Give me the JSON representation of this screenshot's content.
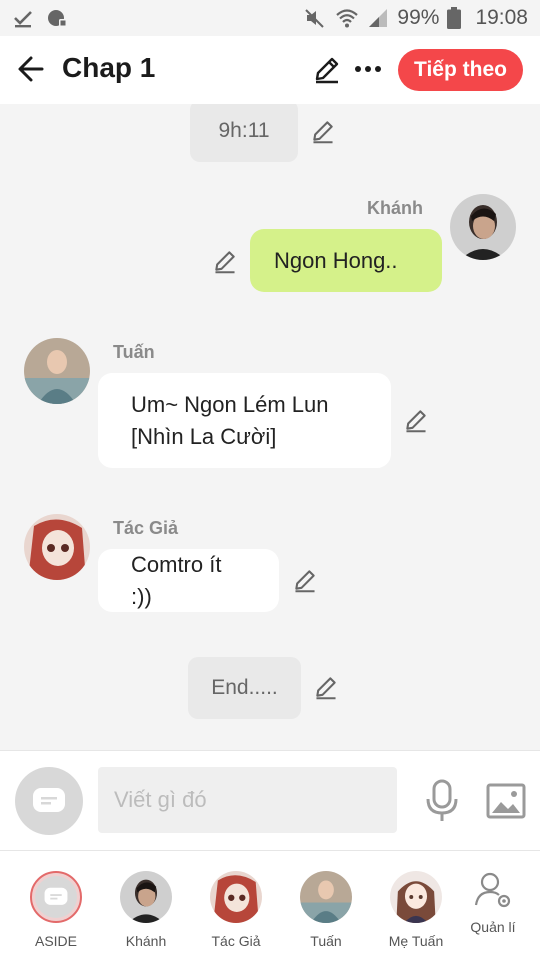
{
  "status_bar": {
    "battery": "99%",
    "time": "19:08"
  },
  "header": {
    "title": "Chap 1",
    "next_label": "Tiếp theo"
  },
  "messages": {
    "time_chip": "9h:11",
    "m1": {
      "sender": "Khánh",
      "text": "Ngon Hong.."
    },
    "m2": {
      "sender": "Tuấn",
      "line1": "Um~ Ngon Lém Lun",
      "line2": "[Nhìn La Cười]"
    },
    "m3": {
      "sender": "Tác Giả",
      "text": "Comtro ít :))"
    },
    "end_chip": "End....."
  },
  "composer": {
    "placeholder": "Viết gì đó"
  },
  "bottom_nav": {
    "items": [
      {
        "label": "ASIDE"
      },
      {
        "label": "Khánh"
      },
      {
        "label": "Tác Giả"
      },
      {
        "label": "Tuấn"
      },
      {
        "label": "Mẹ Tuấn"
      },
      {
        "label": "Quản lí"
      }
    ]
  },
  "colors": {
    "accent": "#f4474a",
    "own_bubble": "#d5f18a",
    "background": "#f4f4f4"
  }
}
